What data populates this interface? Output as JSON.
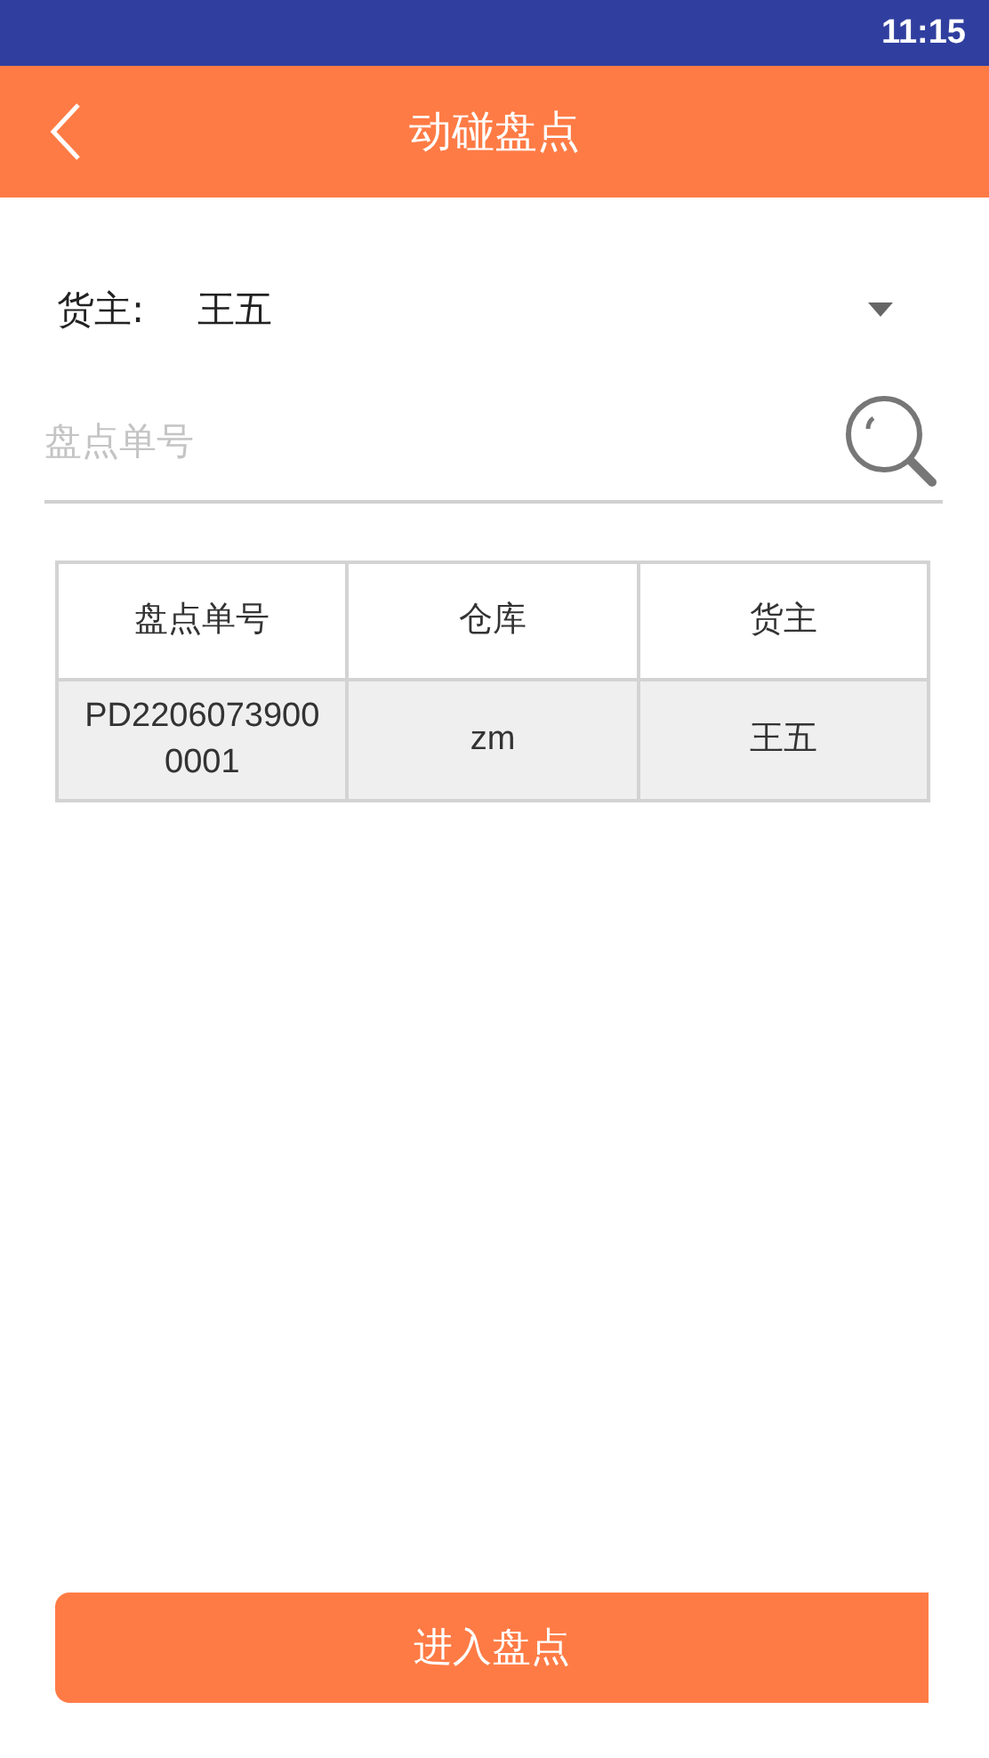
{
  "status_bar": {
    "time": "11:15"
  },
  "header": {
    "title": "动碰盘点"
  },
  "owner": {
    "label": "货主:",
    "value": "王五"
  },
  "search": {
    "placeholder": "盘点单号"
  },
  "table": {
    "columns": [
      "盘点单号",
      "仓库",
      "货主"
    ],
    "rows": [
      {
        "cells": [
          "PD22060739000001",
          "zm",
          "王五"
        ],
        "selected": true
      }
    ]
  },
  "button": {
    "label": "进入盘点"
  }
}
